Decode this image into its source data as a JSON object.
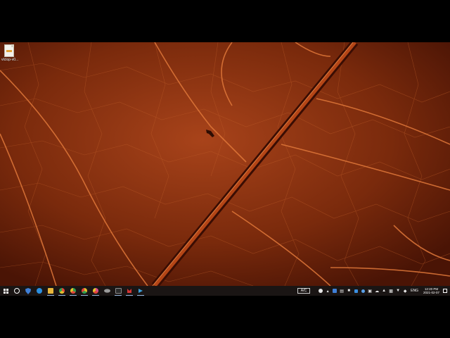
{
  "desktop": {
    "icons": [
      {
        "label": "vlctop-v0....",
        "icon": "file-icon"
      }
    ]
  },
  "taskbar": {
    "start": {
      "icon": "windows-start-icon"
    },
    "pinned": [
      {
        "name": "search",
        "icon": "search-icon",
        "color": "#ffffff"
      },
      {
        "name": "shield",
        "icon": "shield-icon",
        "color": "#3f7fd6"
      },
      {
        "name": "edge",
        "icon": "edge-icon",
        "color": "#2b8fe0"
      },
      {
        "name": "file-explorer",
        "icon": "folder-icon",
        "color": "#e9b73b"
      },
      {
        "name": "chrome-1",
        "icon": "chrome-icon",
        "color": "#e2463a"
      },
      {
        "name": "chrome-2",
        "icon": "chrome-icon",
        "color": "#2fa04f"
      },
      {
        "name": "chrome-3",
        "icon": "chrome-icon",
        "color": "#e6c02b"
      },
      {
        "name": "chrome-4",
        "icon": "chrome-icon",
        "color": "#d94b8a"
      },
      {
        "name": "app-generic",
        "icon": "app-icon",
        "color": "#8a8a8a"
      },
      {
        "name": "terminal",
        "icon": "terminal-icon",
        "color": "#2b2b2b"
      },
      {
        "name": "red-app",
        "icon": "red-app-icon",
        "color": "#d63434"
      },
      {
        "name": "python-app",
        "icon": "python-icon",
        "color": "#3b9fd9"
      }
    ],
    "tray": {
      "pill_label": "A/C",
      "language": "ENG",
      "time": "12:20 PM",
      "date": "2021-02-07"
    }
  }
}
